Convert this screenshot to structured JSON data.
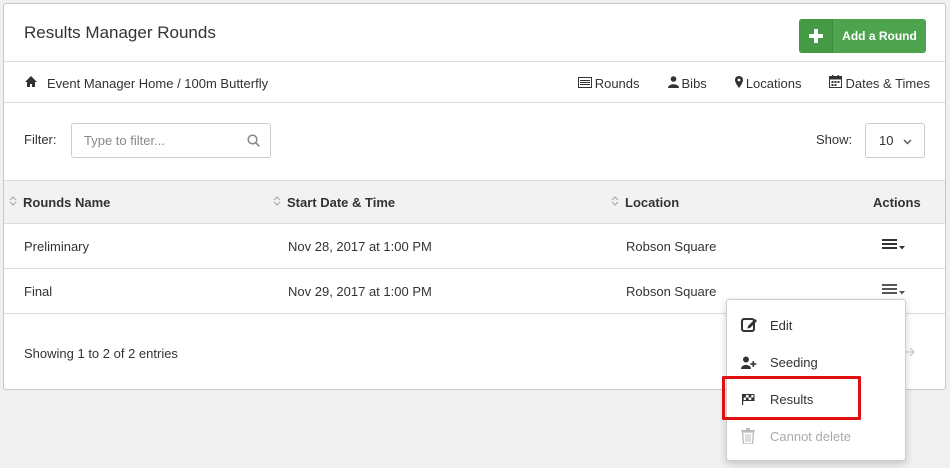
{
  "header": {
    "title": "Results Manager Rounds",
    "add_button_label": "Add a Round",
    "accent_color": "#4ea34e"
  },
  "breadcrumb": {
    "icon": "home-icon",
    "text": "Event Manager Home / 100m Butterfly"
  },
  "nav": [
    {
      "label": "Rounds",
      "icon": "list-icon"
    },
    {
      "label": "Bibs",
      "icon": "user-icon"
    },
    {
      "label": "Locations",
      "icon": "map-marker-icon"
    },
    {
      "label": "Dates & Times",
      "icon": "calendar-icon"
    }
  ],
  "filter": {
    "label": "Filter:",
    "placeholder": "Type to filter..."
  },
  "show": {
    "label": "Show:",
    "value": "10"
  },
  "table": {
    "headers": [
      "Rounds Name",
      "Start Date & Time",
      "Location",
      "Actions"
    ],
    "rows": [
      {
        "name": "Preliminary",
        "start": "Nov 28, 2017 at 1:00 PM",
        "location": "Robson Square"
      },
      {
        "name": "Final",
        "start": "Nov 29, 2017 at 1:00 PM",
        "location": "Robson Square"
      }
    ]
  },
  "footer": {
    "summary": "Showing 1 to 2 of 2 entries"
  },
  "dropdown": {
    "items": [
      {
        "label": "Edit",
        "icon": "edit-icon",
        "enabled": true
      },
      {
        "label": "Seeding",
        "icon": "user-plus-icon",
        "enabled": true
      },
      {
        "label": "Results",
        "icon": "flag-checkered-icon",
        "enabled": true
      },
      {
        "label": "Cannot delete",
        "icon": "trash-icon",
        "enabled": false
      }
    ],
    "highlight_color": "#e01010"
  }
}
